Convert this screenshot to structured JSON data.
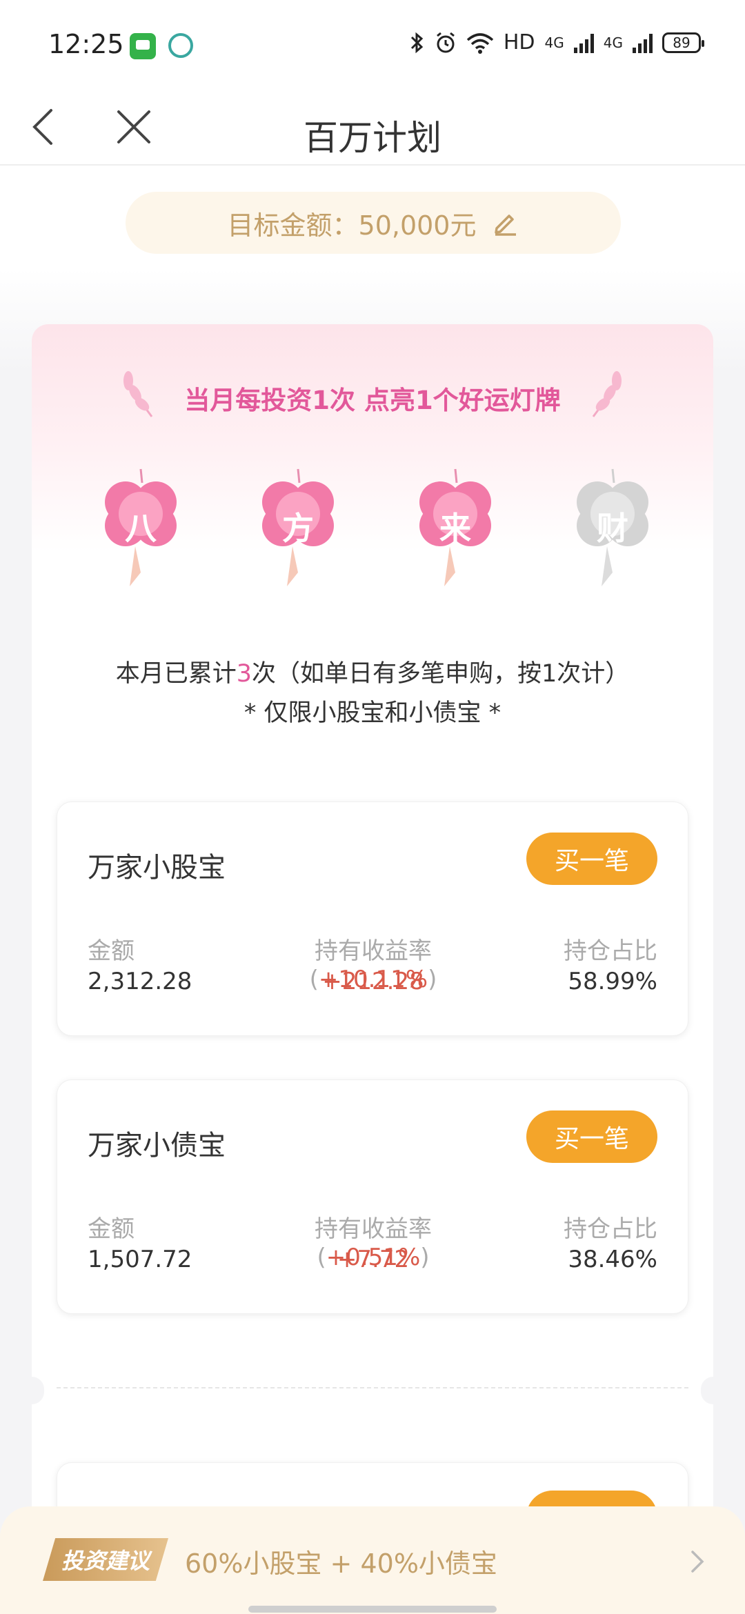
{
  "status_bar": {
    "time": "12:25",
    "battery": "89",
    "network_hd": "HD",
    "network_4g_1": "4G",
    "network_4g_2": "4G"
  },
  "header": {
    "title": "百万计划",
    "back_icon": "back-chevron-icon",
    "close_icon": "close-icon"
  },
  "target": {
    "label": "目标金额：50,000元",
    "edit_icon": "pencil-icon"
  },
  "promo": {
    "line": "当月每投资1次 点亮1个好运灯牌",
    "lanterns": [
      {
        "char": "八",
        "lit": true
      },
      {
        "char": "方",
        "lit": true
      },
      {
        "char": "来",
        "lit": true
      },
      {
        "char": "财",
        "lit": false
      }
    ],
    "count_prefix": "本月已累计",
    "count_value": "3",
    "count_suffix": "次（如单日有多笔申购，按1次计）",
    "note": "* 仅限小股宝和小债宝 *"
  },
  "funds": [
    {
      "name": "万家小股宝",
      "buy_label": "买一笔",
      "amount_label": "金额",
      "amount": "2,312.28",
      "yield_label": "持有收益率(",
      "yield_rate": "+10.11%",
      "yield_close": ")",
      "yield_value": "+212.28",
      "ratio_label": "持仓占比",
      "ratio": "58.99%"
    },
    {
      "name": "万家小债宝",
      "buy_label": "买一笔",
      "amount_label": "金额",
      "amount": "1,507.72",
      "yield_label": "持有收益率(",
      "yield_rate": "+0.51%",
      "yield_close": ")",
      "yield_value": "+7.72",
      "ratio_label": "持仓占比",
      "ratio": "38.46%"
    }
  ],
  "suggestion": {
    "tag": "投资建议",
    "text": "60%小股宝 + 40%小债宝",
    "arrow_icon": "chevron-right-icon"
  },
  "colors": {
    "accent_orange": "#f4a52a",
    "pink_lit": "#f27aa8",
    "gold_text": "#c3a06a",
    "red_gain": "#d95a4a"
  }
}
